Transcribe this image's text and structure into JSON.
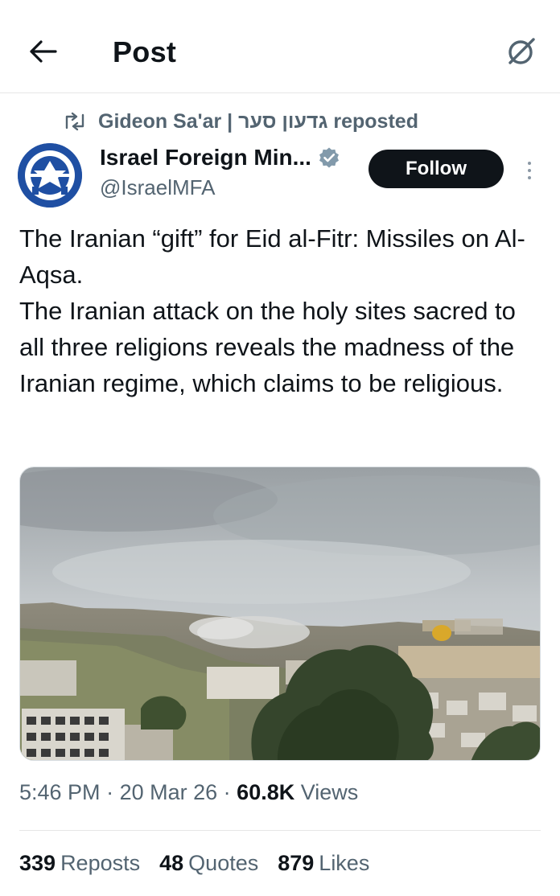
{
  "header": {
    "title": "Post",
    "back_icon": "arrow-left-icon",
    "grok_icon": "grok-icon"
  },
  "repost": {
    "icon": "repost-icon",
    "text": "Gideon Sa'ar | גדעון סער reposted"
  },
  "author": {
    "name": "Israel Foreign Min...",
    "handle": "@IsraelMFA",
    "verified": true,
    "follow_label": "Follow"
  },
  "tweet": {
    "text": "The Iranian “gift” for Eid al-Fitr: Missiles on Al-Aqsa.\nThe Iranian attack on the holy sites sacred to all three religions reveals the madness of the Iranian regime, which claims to be religious."
  },
  "meta": {
    "time": "5:46 PM",
    "date": "20 Mar 26",
    "views_count": "60.8K",
    "views_label": "Views"
  },
  "stats": {
    "reposts_count": "339",
    "reposts_label": "Reposts",
    "quotes_count": "48",
    "quotes_label": "Quotes",
    "likes_count": "879",
    "likes_label": "Likes"
  },
  "colors": {
    "text_primary": "#0f1419",
    "text_secondary": "#536471",
    "verified": "#829aab",
    "avatar_bg": "#1f4fa3"
  }
}
